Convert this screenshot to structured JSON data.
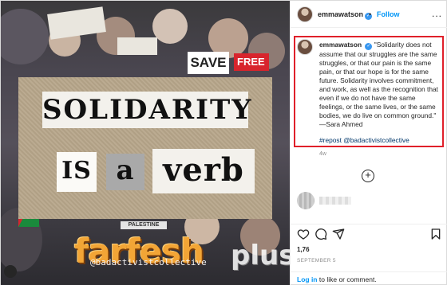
{
  "post": {
    "poster_words": [
      "SOLIDARITY",
      "IS",
      "a",
      "verb"
    ],
    "signs": {
      "save": "SAVE",
      "free": "FREE",
      "palestine": "PALESTINE"
    },
    "watermark": {
      "brand": "farfesh",
      "suffix": "plus.com",
      "handle": "@badactivistcollective"
    }
  },
  "header": {
    "username": "emmawatson",
    "separator": "•",
    "follow_label": "Follow",
    "more_label": "..."
  },
  "caption": {
    "username": "emmawatson",
    "text": "\"Solidarity does not assume that our struggles are the same struggles, or that our pain is the same pain, or that our hope is for the same future. Solidarity involves commitment, and work, as well as the recognition that even if we do not have the same feelings, or the same lives, or the same bodies, we do live on common ground.\" —Sara Ahmed",
    "hashtag": "#repost @badactivistcollective",
    "time_ago": "4w"
  },
  "load_more_label": "+",
  "stats": {
    "likes": "1,76",
    "date": "SEPTEMBER 5"
  },
  "footer": {
    "login_label": "Log in",
    "login_suffix": "to like or comment."
  },
  "colors": {
    "link_blue": "#0095f6",
    "highlight_red": "#e0202a",
    "verified_blue": "#3897f0",
    "watermark_orange": "#f2a536"
  }
}
